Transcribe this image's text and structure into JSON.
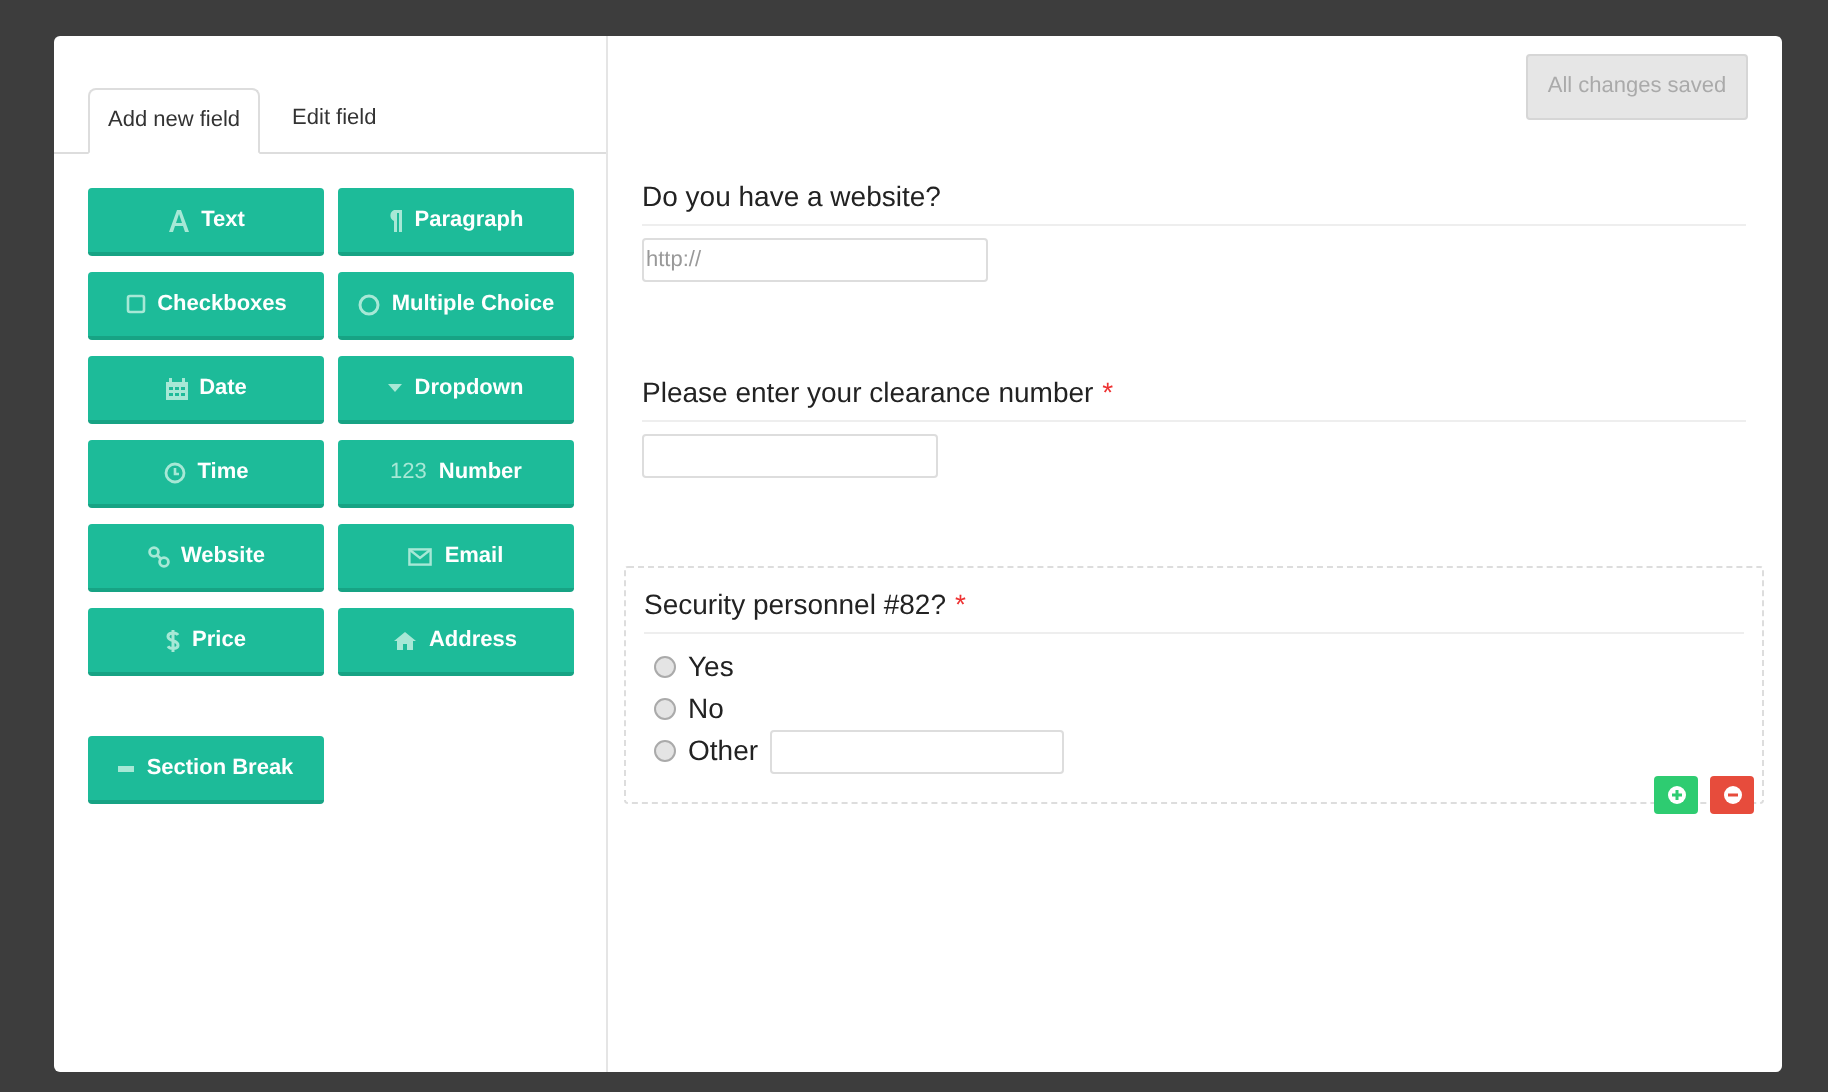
{
  "tabs": [
    {
      "label": "Add new field",
      "selected": true
    },
    {
      "label": "Edit field",
      "selected": false
    }
  ],
  "field_buttons": [
    {
      "label": "Text"
    },
    {
      "label": "Paragraph"
    },
    {
      "label": "Checkboxes"
    },
    {
      "label": "Multiple Choice"
    },
    {
      "label": "Date"
    },
    {
      "label": "Dropdown"
    },
    {
      "label": "Time"
    },
    {
      "label": "Number",
      "prefix": "123"
    },
    {
      "label": "Website"
    },
    {
      "label": "Email"
    },
    {
      "label": "Price"
    },
    {
      "label": "Address"
    }
  ],
  "section_button": {
    "label": "Section Break"
  },
  "save_status": {
    "label": "All changes saved",
    "disabled": true
  },
  "questions": [
    {
      "kind": "url",
      "label": "Do you have a website?",
      "placeholder": "http://",
      "active": false
    },
    {
      "kind": "text",
      "label": "Please enter your clearance number",
      "required_mark": "*",
      "active": false
    },
    {
      "kind": "radio",
      "label": "Security personnel #82?",
      "required_mark": "*",
      "active": true,
      "options": [
        {
          "kind": "choice",
          "label": "Yes",
          "selected": false
        },
        {
          "kind": "choice",
          "label": "No",
          "selected": false
        },
        {
          "kind": "other",
          "label": "Other",
          "selected": false
        }
      ]
    }
  ]
}
